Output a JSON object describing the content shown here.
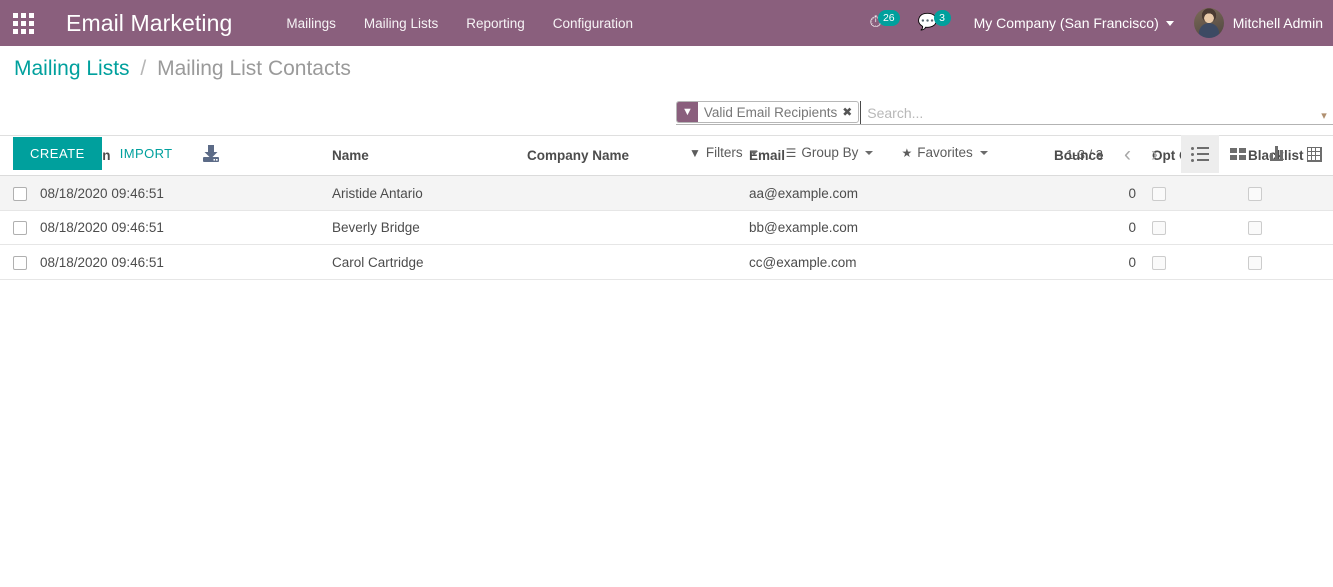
{
  "navbar": {
    "apps_icon": "apps-grid-icon",
    "brand": "Email Marketing",
    "menu": [
      {
        "label": "Mailings"
      },
      {
        "label": "Mailing Lists"
      },
      {
        "label": "Reporting"
      },
      {
        "label": "Configuration"
      }
    ],
    "systray": {
      "activity_icon": "clock-icon",
      "activity_count": "26",
      "messaging_icon": "comment-icon",
      "messaging_count": "3",
      "company": "My Company (San Francisco)",
      "company_caret": "chevron-down-icon",
      "avatar": "user-avatar",
      "user_name": "Mitchell Admin"
    },
    "accent_purple": "#8a5f7d",
    "accent_teal": "#00a09d"
  },
  "control_panel": {
    "breadcrumb": {
      "parent": "Mailing Lists",
      "separator": "/",
      "current": "Mailing List Contacts"
    },
    "buttons": {
      "create": "CREATE",
      "import": "IMPORT",
      "export_icon": "download-icon"
    },
    "search": {
      "facet": {
        "icon": "filter-funnel-icon",
        "label": "Valid Email Recipients",
        "remove_icon": "close-x-icon"
      },
      "placeholder": "Search...",
      "value": "",
      "toggle_icon": "search-caret-icon"
    },
    "dropdowns": [
      {
        "icon": "filter-funnel-icon",
        "label": "Filters"
      },
      {
        "icon": "group-by-lines-icon",
        "label": "Group By"
      },
      {
        "icon": "star-icon",
        "label": "Favorites"
      }
    ],
    "pager": {
      "value": "1-3 / 3",
      "prev_icon": "chevron-left-icon",
      "next_icon": "chevron-right-icon"
    },
    "views": [
      {
        "name": "list",
        "icon": "list-view-icon",
        "active": true
      },
      {
        "name": "kanban",
        "icon": "kanban-view-icon",
        "active": false
      },
      {
        "name": "graph",
        "icon": "graph-view-icon",
        "active": false
      },
      {
        "name": "pivot",
        "icon": "pivot-view-icon",
        "active": false
      }
    ]
  },
  "list": {
    "columns": [
      {
        "key": "created_on",
        "label": "Created on"
      },
      {
        "key": "name",
        "label": "Name"
      },
      {
        "key": "company_name",
        "label": "Company Name"
      },
      {
        "key": "email",
        "label": "Email"
      },
      {
        "key": "bounce",
        "label": "Bounce"
      },
      {
        "key": "opt_out",
        "label": "Opt Out"
      },
      {
        "key": "blacklist",
        "label": "Blacklist"
      }
    ],
    "rows": [
      {
        "created_on": "08/18/2020 09:46:51",
        "name": "Aristide Antario",
        "company_name": "",
        "email": "aa@example.com",
        "bounce": "0",
        "opt_out": false,
        "blacklist": false,
        "highlighted": true
      },
      {
        "created_on": "08/18/2020 09:46:51",
        "name": "Beverly Bridge",
        "company_name": "",
        "email": "bb@example.com",
        "bounce": "0",
        "opt_out": false,
        "blacklist": false,
        "highlighted": false
      },
      {
        "created_on": "08/18/2020 09:46:51",
        "name": "Carol Cartridge",
        "company_name": "",
        "email": "cc@example.com",
        "bounce": "0",
        "opt_out": false,
        "blacklist": false,
        "highlighted": false
      }
    ]
  }
}
